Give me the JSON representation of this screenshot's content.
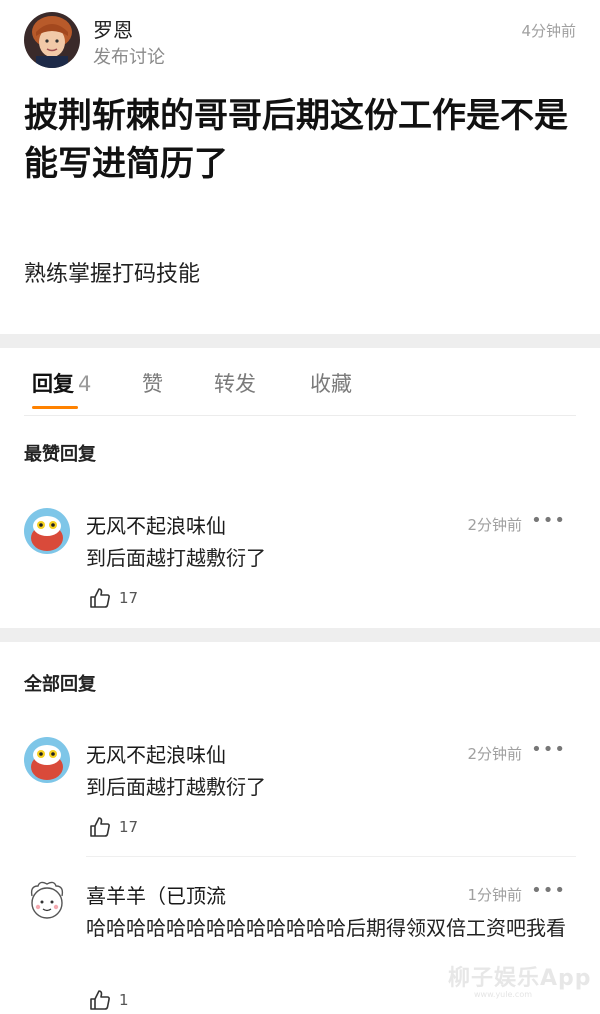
{
  "post": {
    "author": "罗恩",
    "subtitle": "发布讨论",
    "time": "4分钟前",
    "title": "披荆斩棘的哥哥后期这份工作是不是能写进简历了",
    "body": "熟练掌握打码技能"
  },
  "tabs": [
    {
      "label": "回复",
      "count": "4",
      "active": true
    },
    {
      "label": "赞",
      "count": "",
      "active": false
    },
    {
      "label": "转发",
      "count": "",
      "active": false
    },
    {
      "label": "收藏",
      "count": "",
      "active": false
    }
  ],
  "sections": {
    "top_replies": "最赞回复",
    "all_replies": "全部回复"
  },
  "top_comments": [
    {
      "name": "无风不起浪味仙",
      "time": "2分钟前",
      "text": "到后面越打越敷衍了",
      "likes": "17"
    }
  ],
  "all_comments": [
    {
      "name": "无风不起浪味仙",
      "time": "2分钟前",
      "text": "到后面越打越敷衍了",
      "likes": "17"
    },
    {
      "name": "喜羊羊（已顶流",
      "time": "1分钟前",
      "text": "哈哈哈哈哈哈哈哈哈哈哈哈哈后期得领双倍工资吧我看",
      "likes": "1"
    }
  ],
  "more_glyph": "•••",
  "watermark": {
    "text": "柳子娱乐App",
    "sub": "www.yule.com"
  },
  "colors": {
    "accent": "#ff8200",
    "text": "#1a1a1a",
    "muted": "#a0a0a0",
    "divider": "#eeeeee"
  }
}
